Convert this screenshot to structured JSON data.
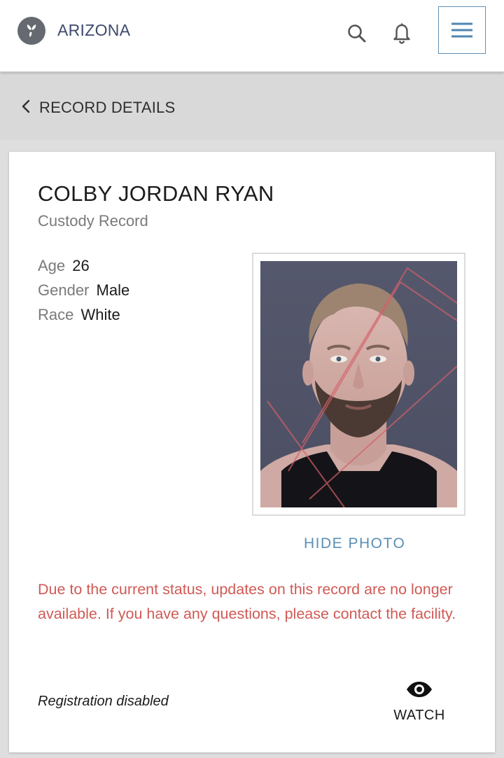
{
  "header": {
    "brand": "ARIZONA",
    "logo_icon": "leaf-logo-icon",
    "search_icon": "search-icon",
    "notifications_icon": "bell-icon",
    "menu_icon": "hamburger-menu-icon"
  },
  "subheader": {
    "back_label": "RECORD DETAILS",
    "back_icon": "chevron-left-icon"
  },
  "record": {
    "name": "COLBY JORDAN RYAN",
    "type": "Custody Record",
    "details": {
      "age_label": "Age",
      "age_value": "26",
      "gender_label": "Gender",
      "gender_value": "Male",
      "race_label": "Race",
      "race_value": "White"
    },
    "hide_photo_label": "HIDE PHOTO",
    "status_message": "Due to the current status, updates on this record are no longer available. If you have any questions, please contact the facility.",
    "registration_status": "Registration disabled",
    "watch_label": "WATCH",
    "watch_icon": "eye-icon"
  },
  "colors": {
    "brand_text": "#3d4a6e",
    "accent_blue": "#5a8fb5",
    "alert_red": "#d05a55"
  }
}
